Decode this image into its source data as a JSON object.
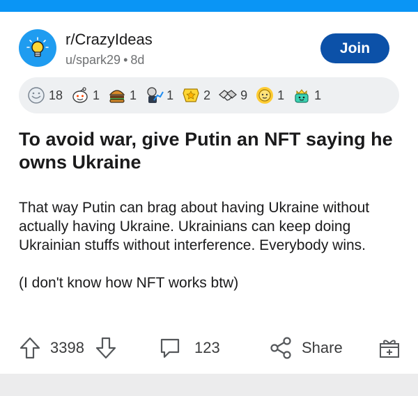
{
  "subreddit": {
    "name": "r/CrazyIdeas",
    "author": "u/spark29",
    "separator": "•",
    "age": "8d",
    "join_label": "Join"
  },
  "awards": [
    {
      "icon": "silver-award-icon",
      "count": "18"
    },
    {
      "icon": "wholesome-award-icon",
      "count": "1"
    },
    {
      "icon": "burger-award-icon",
      "count": "1"
    },
    {
      "icon": "stonks-award-icon",
      "count": "1"
    },
    {
      "icon": "gold-star-award-icon",
      "count": "2"
    },
    {
      "icon": "handshake-award-icon",
      "count": "9"
    },
    {
      "icon": "sun-award-icon",
      "count": "1"
    },
    {
      "icon": "crown-award-icon",
      "count": "1"
    }
  ],
  "post": {
    "title": "To avoid war, give Putin an NFT saying he owns Ukraine",
    "paragraphs": [
      "That way Putin can brag about having Ukraine without actually having Ukraine. Ukrainians can keep doing Ukrainian stuffs without interference. Everybody wins.",
      "(I don't know how NFT works btw)"
    ]
  },
  "actions": {
    "score": "3398",
    "comments": "123",
    "share_label": "Share"
  },
  "colors": {
    "accent": "#0a95f5",
    "join": "#0c51a8",
    "award_bg": "#eef0f2",
    "icon": "#54575a"
  }
}
